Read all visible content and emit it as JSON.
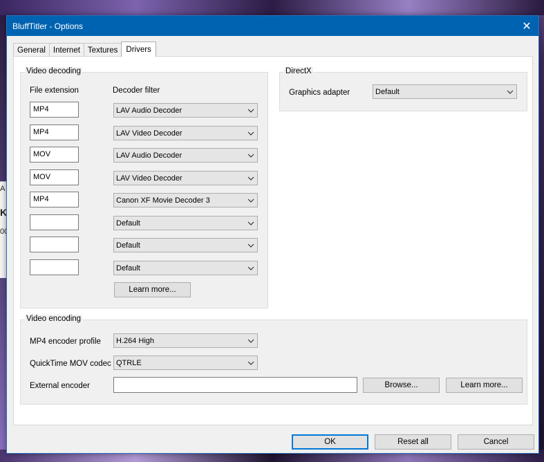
{
  "window": {
    "title": "BluffTitler - Options",
    "close_glyph": "✕"
  },
  "tabs": [
    {
      "label": "General"
    },
    {
      "label": "Internet"
    },
    {
      "label": "Textures"
    },
    {
      "label": "Drivers"
    }
  ],
  "active_tab": "Drivers",
  "video_decoding": {
    "group_label": "Video decoding",
    "col_extension": "File extension",
    "col_filter": "Decoder filter",
    "rows": [
      {
        "extension": "MP4",
        "filter": "LAV Audio Decoder"
      },
      {
        "extension": "MP4",
        "filter": "LAV Video Decoder"
      },
      {
        "extension": "MOV",
        "filter": "LAV Audio Decoder"
      },
      {
        "extension": "MOV",
        "filter": "LAV Video Decoder"
      },
      {
        "extension": "MP4",
        "filter": "Canon XF Movie Decoder 3"
      },
      {
        "extension": "",
        "filter": "Default"
      },
      {
        "extension": "",
        "filter": "Default"
      },
      {
        "extension": "",
        "filter": "Default"
      }
    ],
    "learn_more": "Learn more..."
  },
  "directx": {
    "group_label": "DirectX",
    "adapter_label": "Graphics adapter",
    "adapter_value": "Default"
  },
  "video_encoding": {
    "group_label": "Video encoding",
    "mp4_profile_label": "MP4 encoder profile",
    "mp4_profile_value": "H.264 High",
    "mov_codec_label": "QuickTime MOV codec",
    "mov_codec_value": "QTRLE",
    "external_encoder_label": "External encoder",
    "external_encoder_value": "",
    "browse": "Browse...",
    "learn_more": "Learn more..."
  },
  "footer": {
    "ok": "OK",
    "reset_all": "Reset all",
    "cancel": "Cancel"
  },
  "background_fragments": [
    "A",
    "K",
    "00"
  ],
  "colors": {
    "titlebar": "#0063b1",
    "focus_border": "#0078d7"
  }
}
